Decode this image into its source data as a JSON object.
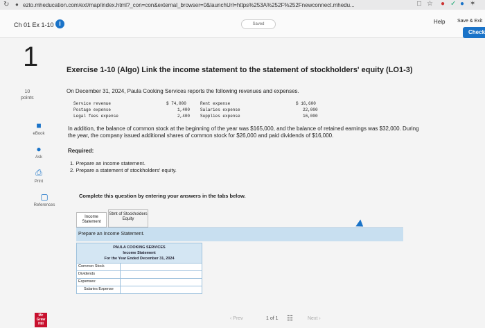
{
  "browser": {
    "url": "ezto.mheducation.com/ext/map/index.html?_con=con&external_browser=0&launchUrl=https%253A%252F%252Fnewconnect.mhedu...",
    "reload_icon": "reload-icon",
    "lock_icon": "lock-icon"
  },
  "header": {
    "chapter": "Ch 01 Ex 1-10",
    "saved": "Saved",
    "help": "Help",
    "save_exit": "Save & Exit",
    "check": "Check"
  },
  "left_rail": {
    "question_number": "1",
    "points_value": "10",
    "points_label": "points",
    "tools": [
      {
        "label": "eBook",
        "icon": "book-icon"
      },
      {
        "label": "Ask",
        "icon": "chat-bubble-icon"
      },
      {
        "label": "Print",
        "icon": "printer-icon"
      },
      {
        "label": "References",
        "icon": "document-icon"
      }
    ],
    "logo": "Mc Graw Hill"
  },
  "exercise": {
    "title": "Exercise 1-10 (Algo) Link the income statement to the statement of stockholders' equity (LO1-3)",
    "intro": "On December 31, 2024, Paula Cooking Services reports the following revenues and expenses.",
    "data_rows": [
      {
        "l_label": "Service revenue",
        "l_value": "$ 74,000",
        "r_label": "Rent expense",
        "r_value": "$ 16,600"
      },
      {
        "l_label": "Postage expense",
        "l_value": "1,400",
        "r_label": "Salaries expense",
        "r_value": "22,000"
      },
      {
        "l_label": "Legal fees expense",
        "l_value": "2,400",
        "r_label": "Supplies expense",
        "r_value": "16,000"
      }
    ],
    "paragraph": "In addition, the balance of common stock at the beginning of the year was $165,000, and the balance of retained earnings was $32,000. During the year, the company issued additional shares of common stock for $26,000 and paid dividends of $16,000.",
    "required_label": "Required:",
    "required_items": [
      "1. Prepare an income statement.",
      "2. Prepare a statement of stockholders' equity."
    ],
    "complete_instruction": "Complete this question by entering your answers in the tabs below."
  },
  "tabs": [
    {
      "label": "Income Statement"
    },
    {
      "label": "Stmt of Stockholders Equity"
    }
  ],
  "panel": {
    "instruction": "Prepare an Income Statement.",
    "company": "PAULA COOKING SERVICES",
    "statement": "Income Statement",
    "period": "For the Year Ended December 31, 2024",
    "rows": [
      "Common Stock",
      "Dividends",
      "Expenses:",
      "Salaries Expense"
    ]
  },
  "pager": {
    "prev": "Prev",
    "page_current": "1",
    "page_of": "of",
    "page_total": "1",
    "next": "Next"
  }
}
